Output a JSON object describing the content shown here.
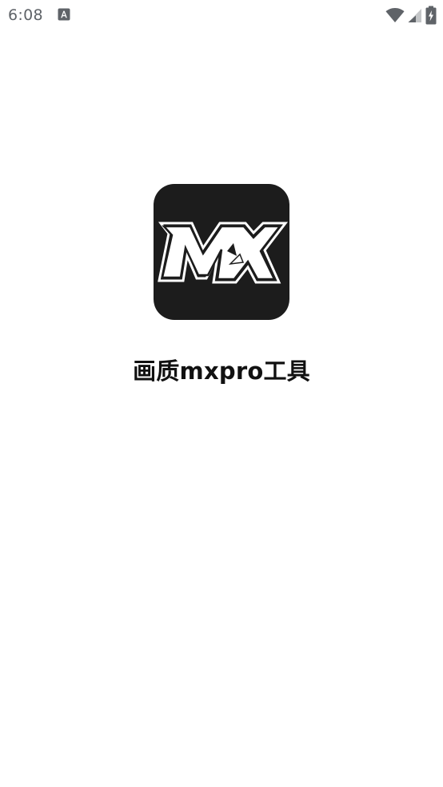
{
  "status_bar": {
    "time": "6:08",
    "notification_icon": "text-a-icon",
    "wifi_icon": "wifi-icon",
    "signal_icon": "cellular-signal-icon",
    "battery_icon": "battery-charging-icon"
  },
  "splash": {
    "logo_icon": "mx-logo-icon",
    "logo_text": "MX",
    "app_name": "画质mxpro工具"
  },
  "colors": {
    "background": "#ffffff",
    "logo_background": "#1c1c1c",
    "status_icons": "#5f6368",
    "title": "#111111"
  }
}
